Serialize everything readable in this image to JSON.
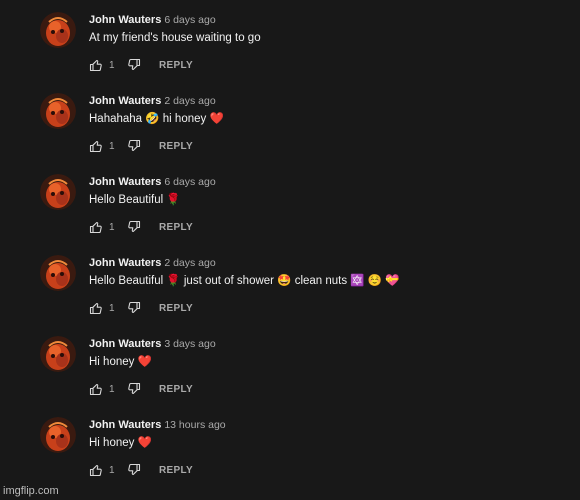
{
  "comments": [
    {
      "author": "John Wauters",
      "time": "6 days ago",
      "text": "At my friend's house waiting to go",
      "likes": "1",
      "reply_label": "REPLY"
    },
    {
      "author": "John Wauters",
      "time": "2 days ago",
      "text": "Hahahaha 🤣 hi honey ❤️",
      "likes": "1",
      "reply_label": "REPLY"
    },
    {
      "author": "John Wauters",
      "time": "6 days ago",
      "text": "Hello Beautiful 🌹",
      "likes": "1",
      "reply_label": "REPLY"
    },
    {
      "author": "John Wauters",
      "time": "2 days ago",
      "text": "Hello Beautiful 🌹  just out of shower 🤩  clean nuts 🔯 ☺️ 💝",
      "likes": "1",
      "reply_label": "REPLY"
    },
    {
      "author": "John Wauters",
      "time": "3 days ago",
      "text": "Hi honey ❤️",
      "likes": "1",
      "reply_label": "REPLY"
    },
    {
      "author": "John Wauters",
      "time": "13 hours ago",
      "text": "Hi honey ❤️",
      "likes": "1",
      "reply_label": "REPLY"
    }
  ],
  "watermark": "imgflip.com",
  "icons": {
    "avatar": "avatar-icon",
    "like": "thumbs-up-icon",
    "dislike": "thumbs-down-icon"
  },
  "colors": {
    "background": "#181818",
    "author_text": "#f1f1f1",
    "secondary_text": "#aaaaaa",
    "avatar_orange": "#d9461c"
  }
}
